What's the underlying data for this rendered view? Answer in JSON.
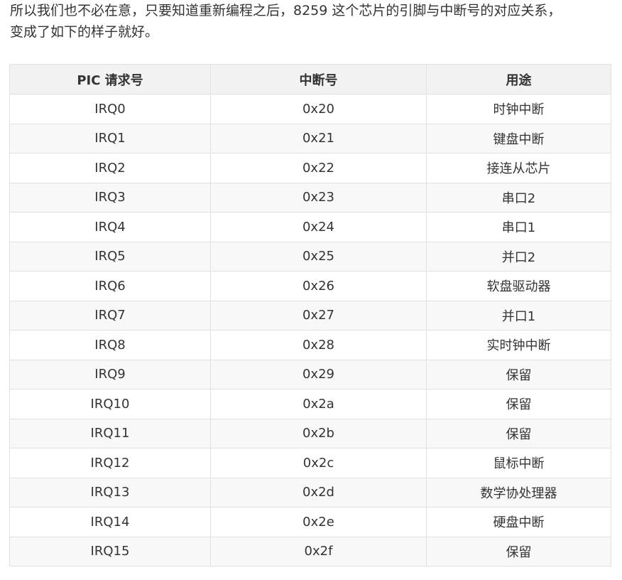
{
  "paragraph": {
    "line1": "所以我们也不必在意，只要知道重新编程之后，8259 这个芯片的引脚与中断号的对应关系，",
    "line2": "变成了如下的样子就好。"
  },
  "table": {
    "headers": [
      "PIC 请求号",
      "中断号",
      "用途"
    ],
    "rows": [
      [
        "IRQ0",
        "0x20",
        "时钟中断"
      ],
      [
        "IRQ1",
        "0x21",
        "键盘中断"
      ],
      [
        "IRQ2",
        "0x22",
        "接连从芯片"
      ],
      [
        "IRQ3",
        "0x23",
        "串口2"
      ],
      [
        "IRQ4",
        "0x24",
        "串口1"
      ],
      [
        "IRQ5",
        "0x25",
        "并口2"
      ],
      [
        "IRQ6",
        "0x26",
        "软盘驱动器"
      ],
      [
        "IRQ7",
        "0x27",
        "并口1"
      ],
      [
        "IRQ8",
        "0x28",
        "实时钟中断"
      ],
      [
        "IRQ9",
        "0x29",
        "保留"
      ],
      [
        "IRQ10",
        "0x2a",
        "保留"
      ],
      [
        "IRQ11",
        "0x2b",
        "保留"
      ],
      [
        "IRQ12",
        "0x2c",
        "鼠标中断"
      ],
      [
        "IRQ13",
        "0x2d",
        "数学协处理器"
      ],
      [
        "IRQ14",
        "0x2e",
        "硬盘中断"
      ],
      [
        "IRQ15",
        "0x2f",
        "保留"
      ]
    ]
  },
  "colors": {
    "text": "#333333",
    "header_bg": "#f2f2f2",
    "stripe_bg": "#f8f8f8",
    "border": "#dfe2e5"
  }
}
